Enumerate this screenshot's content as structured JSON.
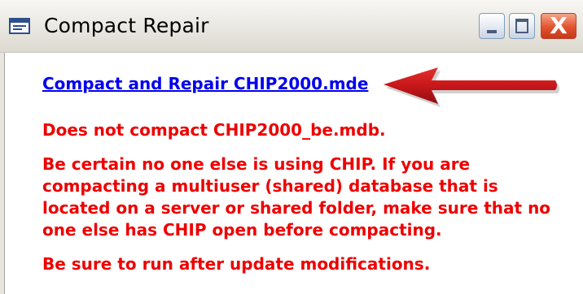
{
  "window": {
    "title": "Compact Repair",
    "icon": "form-icon",
    "controls": {
      "minimize": "minimize-icon",
      "maximize": "maximize-icon",
      "close": "close-icon"
    },
    "close_glyph": "X"
  },
  "content": {
    "link_text": "Compact and Repair CHIP2000.mde",
    "notes": [
      "Does not compact CHIP2000_be.mdb.",
      "Be certain no one else is using CHIP. If you are compacting a multiuser (shared) database that is located on a server or shared folder, make sure that no one else has CHIP open before compacting.",
      "Be sure to run after update modifications."
    ]
  },
  "colors": {
    "link": "#0000ee",
    "warning_text": "#ee0000",
    "arrow": "#c8171a"
  }
}
